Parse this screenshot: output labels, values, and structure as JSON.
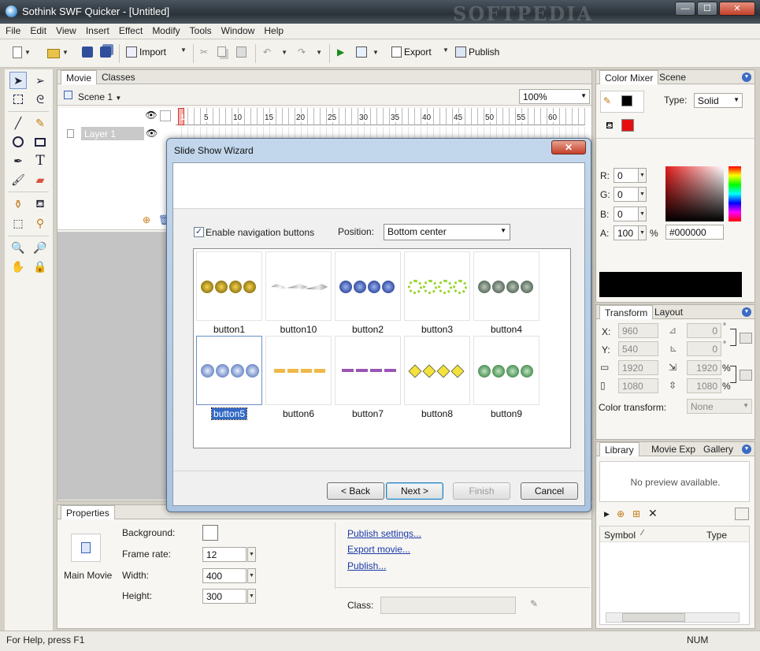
{
  "window": {
    "title": "Sothink SWF Quicker - [Untitled]",
    "watermark": "SOFTPEDIA",
    "min": "—",
    "max": "☐",
    "close": "✕"
  },
  "menu": [
    "File",
    "Edit",
    "View",
    "Insert",
    "Effect",
    "Modify",
    "Tools",
    "Window",
    "Help"
  ],
  "toolbar": {
    "import": "Import",
    "export": "Export",
    "publish": "Publish"
  },
  "doc": {
    "tabs": [
      "Movie",
      "Classes"
    ],
    "scene": "Scene 1",
    "zoom": "100%",
    "layer": "Layer 1",
    "ruler": [
      "1",
      "5",
      "10",
      "15",
      "20",
      "25",
      "30",
      "35",
      "40",
      "45",
      "50",
      "55",
      "60"
    ]
  },
  "dialog": {
    "title": "Slide Show Wizard",
    "close": "✕",
    "enable_nav": "Enable navigation buttons",
    "position_label": "Position:",
    "position_value": "Bottom center",
    "buttons": [
      "button1",
      "button10",
      "button2",
      "button3",
      "button4",
      "button5",
      "button6",
      "button7",
      "button8",
      "button9"
    ],
    "back": "< Back",
    "next": "Next >",
    "finish": "Finish",
    "cancel": "Cancel"
  },
  "properties": {
    "tab": "Properties",
    "main_movie": "Main Movie",
    "background_label": "Background:",
    "frame_rate_label": "Frame rate:",
    "frame_rate": "12",
    "width_label": "Width:",
    "width": "400",
    "height_label": "Height:",
    "height": "300",
    "publish_settings": "Publish settings...",
    "export_movie": "Export movie...",
    "publish": "Publish...",
    "class_label": "Class:"
  },
  "color_mixer": {
    "tabs": [
      "Color Mixer",
      "Scene"
    ],
    "type_label": "Type:",
    "type": "Solid",
    "r_label": "R:",
    "r": "0",
    "g_label": "G:",
    "g": "0",
    "b_label": "B:",
    "b": "0",
    "a_label": "A:",
    "a": "100",
    "pct": "%",
    "hex": "#000000"
  },
  "transform": {
    "tabs": [
      "Transform",
      "Layout"
    ],
    "x_label": "X:",
    "x": "960",
    "y_label": "Y:",
    "y": "540",
    "skew1": "0",
    "skew2": "0",
    "w": "1920",
    "h": "1080",
    "sw": "1920",
    "sh": "1080",
    "pct": "%",
    "color_transform_label": "Color transform:",
    "color_transform": "None"
  },
  "library": {
    "tabs": [
      "Library",
      "Movie Exp",
      "Gallery"
    ],
    "preview": "No preview available.",
    "col_symbol": "Symbol",
    "col_type": "Type"
  },
  "status": {
    "help": "For Help, press F1",
    "num": "NUM"
  },
  "colors": {
    "accent": "#3169c6",
    "dialog_bg": "#f0f0f0"
  }
}
